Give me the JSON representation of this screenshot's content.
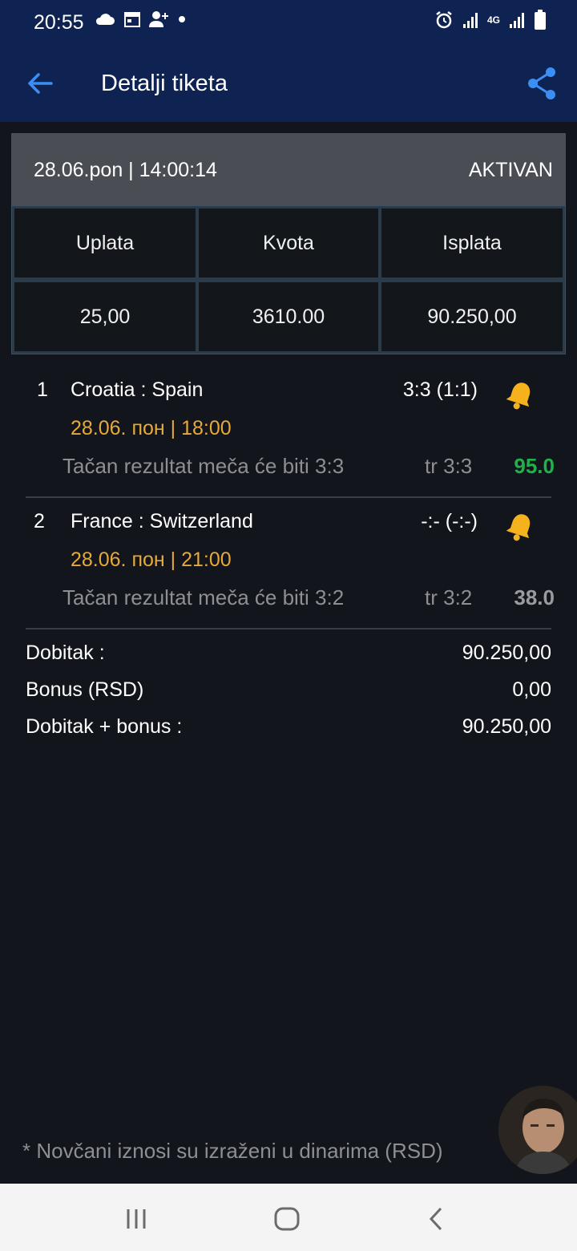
{
  "status_bar": {
    "time": "20:55",
    "network": "4G",
    "icons": [
      "cloud-icon",
      "calendar-icon",
      "contact-add-icon",
      "dot-icon",
      "alarm-icon",
      "signal-icon",
      "network-4g-icon",
      "signal-icon",
      "battery-icon"
    ]
  },
  "header": {
    "title": "Detalji tiketa",
    "back_icon": "arrow-left-icon",
    "share_icon": "share-icon",
    "accent": "#0f2352"
  },
  "ticket": {
    "date": "28.06.pon | 14:00:14",
    "status": "AKTIVAN",
    "columns": [
      "Uplata",
      "Kvota",
      "Isplata"
    ],
    "values": [
      "25,00",
      "3610.00",
      "90.250,00"
    ]
  },
  "matches": [
    {
      "num": "1",
      "teams": "Croatia : Spain",
      "score": "3:3 (1:1)",
      "time": "28.06. пон | 18:00",
      "bet": "Tačan rezultat meča će biti 3:3",
      "tip": "tr 3:3",
      "odd": "95.0",
      "odd_color": "#1fb14a"
    },
    {
      "num": "2",
      "teams": "France : Switzerland",
      "score": "-:- (-:-)",
      "time": "28.06. пон | 21:00",
      "bet": "Tačan rezultat meča će biti 3:2",
      "tip": "tr 3:2",
      "odd": "38.0",
      "odd_color": "#9a9ba0"
    }
  ],
  "summary": [
    {
      "label": "Dobitak :",
      "value": "90.250,00"
    },
    {
      "label": "Bonus (RSD)",
      "value": "0,00"
    },
    {
      "label": "Dobitak + bonus :",
      "value": "90.250,00"
    }
  ],
  "footnote": "* Novčani iznosi su izraženi u dinarima (RSD)",
  "colors": {
    "background": "#12151b",
    "time_accent": "#e7a93a",
    "bell": "#f5b21d",
    "link_blue": "#3c8ef5"
  },
  "navbar": {
    "icons": [
      "recent-apps-icon",
      "home-icon",
      "back-icon"
    ]
  }
}
